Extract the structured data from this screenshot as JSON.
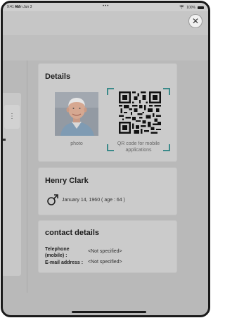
{
  "status_bar": {
    "time": "9:41 AM",
    "date": "Mon Jun 3",
    "dots": "•••",
    "battery": "100%"
  },
  "background": {
    "kebab_glyph": "⋮"
  },
  "close_button": {
    "glyph": "✕",
    "icon": "close-icon"
  },
  "details": {
    "title": "Details",
    "photo_label": "photo",
    "qr_caption": "QR code for mobile applications"
  },
  "patient": {
    "name": "Henry Clark",
    "gender_icon": "male-icon",
    "dob": "January 14, 1960 ( age : 64 )"
  },
  "contact": {
    "title": "contact details",
    "telephone_label": "Telephone (mobile) :",
    "telephone_value": "<Not specified>",
    "email_label": "E-mail address :",
    "email_value": "<Not specified>"
  },
  "colors": {
    "accent": "#3b8a8a",
    "overlay": "#b9b9b9",
    "card": "#cbcbcb"
  }
}
